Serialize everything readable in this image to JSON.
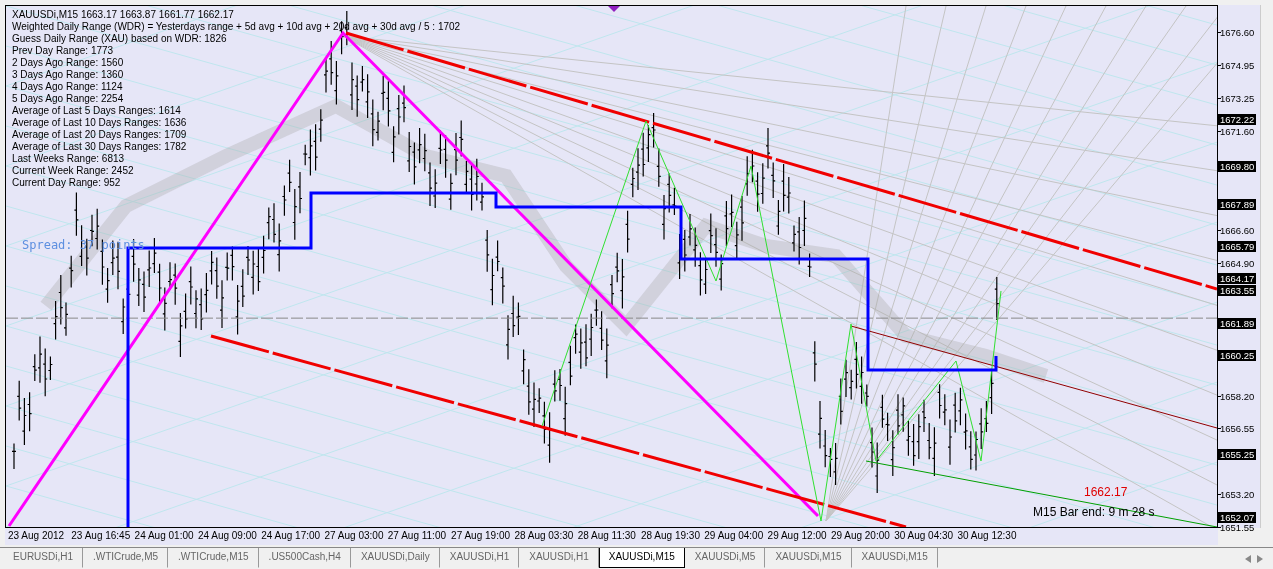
{
  "header_lines": [
    "XAUUSDi,M15  1663.17 1663.87 1661.77 1662.17",
    "Weighted Daily Range (WDR) = Yesterdays range + 5d avg + 10d avg + 20d avg + 30d avg / 5 : 1702",
    "Guess Daily Range (XAU) based on WDR: 1826",
    "Prev Day Range: 1773",
    "2 Days Ago Range: 1560",
    "3 Days Ago Range: 1360",
    "4 Days Ago Range: 1124",
    "5 Days Ago Range: 2254",
    "Average of Last 5 Days Ranges: 1614",
    "Average of Last 10 Days Ranges: 1636",
    "Average of Last 20 Days Ranges: 1709",
    "Average of Last 30 Days Ranges: 1782",
    "Last Weeks Range: 6813",
    "Current Week Range: 2452",
    "Current Day Range: 952"
  ],
  "spread": "Spread: 37 points",
  "current_price": "1662.17",
  "bar_timer": "M15 Bar end: 9 m 28 s",
  "price_labels": [
    "1676.60",
    "1674.95",
    "1673.25",
    "1671.60",
    "1666.60",
    "1664.90",
    "1658.20",
    "1656.55",
    "1653.20",
    "1651.55"
  ],
  "price_markers": [
    "1672.22",
    "1669.80",
    "1667.89",
    "1665.79",
    "1664.17",
    "1663.55",
    "1661.89",
    "1660.25",
    "1655.25",
    "1652.07"
  ],
  "date_labels": [
    "23 Aug 2012",
    "23 Aug 16:45",
    "24 Aug 01:00",
    "24 Aug 09:00",
    "24 Aug 17:00",
    "27 Aug 03:00",
    "27 Aug 11:00",
    "27 Aug 19:00",
    "28 Aug 03:30",
    "28 Aug 11:30",
    "28 Aug 19:30",
    "29 Aug 04:00",
    "29 Aug 12:00",
    "29 Aug 20:00",
    "30 Aug 04:30",
    "30 Aug 12:30"
  ],
  "tabs": [
    {
      "label": "EURUSDi,H1",
      "selected": false
    },
    {
      "label": ".WTICrude,M5",
      "selected": false
    },
    {
      "label": ".WTICrude,M15",
      "selected": false
    },
    {
      "label": ".US500Cash,H4",
      "selected": false
    },
    {
      "label": "XAUUSDi,Daily",
      "selected": false
    },
    {
      "label": "XAUUSDi,H1",
      "selected": false
    },
    {
      "label": "XAUUSDi,H1",
      "selected": false
    },
    {
      "label": "XAUUSDi,M15",
      "selected": true
    },
    {
      "label": "XAUUSDi,M5",
      "selected": false
    },
    {
      "label": "XAUUSDi,M15",
      "selected": false
    },
    {
      "label": "XAUUSDi,M15",
      "selected": false
    }
  ]
}
